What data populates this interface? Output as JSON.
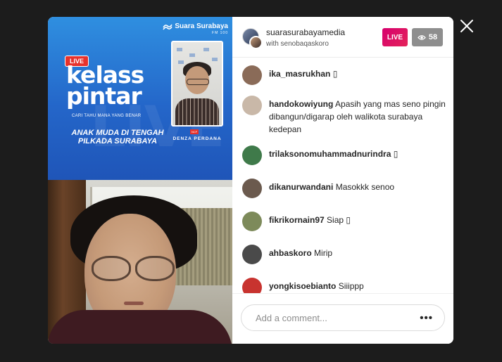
{
  "banner": {
    "brand_name": "Suara Surabaya",
    "brand_sub": "FM 100",
    "live_label": "LIVE",
    "title_line1": "kelass",
    "title_line2": "pintar",
    "tagline": "CARI TAHU MANA YANG BENAR",
    "subtitle": "ANAK MUDA DI TENGAH PILKADA SURABAYA",
    "speaker_tag": "NCF",
    "speaker_name": "DENZA PERDANA"
  },
  "header": {
    "host_username": "suarasurabayamedia",
    "with_text": "with senobaqaskoro",
    "live_badge": "LIVE",
    "viewer_count": "58"
  },
  "comments": [
    {
      "user": "ika_masrukhan",
      "text": "▯",
      "avatar_color": "#8a6b58"
    },
    {
      "user": "handokowiyung",
      "text": "Apasih yang mas seno pingin dibangun/digarap oleh walikota surabaya kedepan",
      "avatar_color": "#c9b8a8"
    },
    {
      "user": "trilaksonomuhammadnurindra",
      "text": "▯",
      "avatar_color": "#3f7a4a"
    },
    {
      "user": "dikanurwandani",
      "text": "Masokkk senoo",
      "avatar_color": "#6b5a4e"
    },
    {
      "user": "fikrikornain97",
      "text": "Siap ▯",
      "avatar_color": "#7d8a5a"
    },
    {
      "user": "ahbaskoro",
      "text": "Mirip",
      "avatar_color": "#4a4a4a"
    },
    {
      "user": "yongkisoebianto",
      "text": "Siiippp",
      "avatar_color": "#c8332f"
    }
  ],
  "composer": {
    "placeholder": "Add a comment...",
    "more_label": "•••"
  },
  "icons": {
    "close": "close-icon",
    "eye": "eye-icon",
    "more": "more-options-icon"
  }
}
